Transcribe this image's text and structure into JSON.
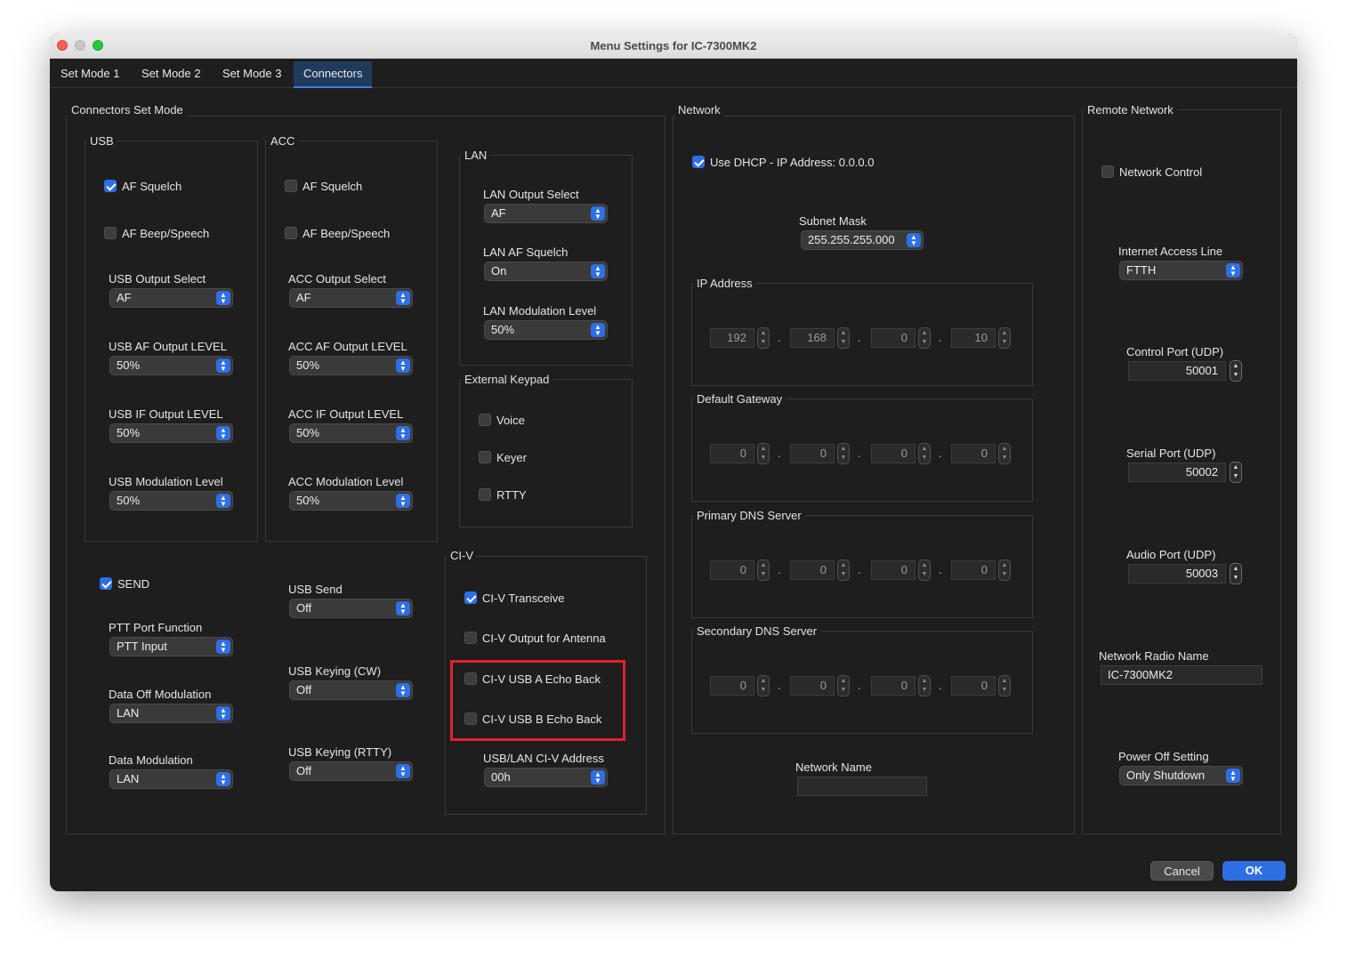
{
  "window": {
    "title": "Menu Settings for IC-7300MK2"
  },
  "colors": {
    "accent": "#2f6fe4",
    "highlight": "#e0222b",
    "close": "#fe5f57",
    "minimize": "#febc2e",
    "zoom": "#28c840"
  },
  "tabs": [
    {
      "label": "Set Mode 1",
      "active": false
    },
    {
      "label": "Set Mode 2",
      "active": false
    },
    {
      "label": "Set Mode 3",
      "active": false
    },
    {
      "label": "Connectors",
      "active": true
    }
  ],
  "connectors": {
    "title": "Connectors Set Mode",
    "usb": {
      "title": "USB",
      "af_squelch": {
        "label": "AF Squelch",
        "checked": true
      },
      "af_beep": {
        "label": "AF Beep/Speech",
        "checked": false
      },
      "output_select": {
        "label": "USB Output Select",
        "value": "AF"
      },
      "af_output_level": {
        "label": "USB AF Output LEVEL",
        "value": "50%"
      },
      "if_output_level": {
        "label": "USB IF Output LEVEL",
        "value": "50%"
      },
      "modulation_level": {
        "label": "USB Modulation Level",
        "value": "50%"
      }
    },
    "acc": {
      "title": "ACC",
      "af_squelch": {
        "label": "AF Squelch",
        "checked": false
      },
      "af_beep": {
        "label": "AF Beep/Speech",
        "checked": false
      },
      "output_select": {
        "label": "ACC Output Select",
        "value": "AF"
      },
      "af_output_level": {
        "label": "ACC AF Output LEVEL",
        "value": "50%"
      },
      "if_output_level": {
        "label": "ACC IF Output LEVEL",
        "value": "50%"
      },
      "modulation_level": {
        "label": "ACC Modulation Level",
        "value": "50%"
      }
    },
    "lan": {
      "title": "LAN",
      "output_select": {
        "label": "LAN Output Select",
        "value": "AF"
      },
      "af_squelch": {
        "label": "LAN AF Squelch",
        "value": "On"
      },
      "modulation_level": {
        "label": "LAN Modulation Level",
        "value": "50%"
      }
    },
    "keypad": {
      "title": "External Keypad",
      "voice": {
        "label": "Voice",
        "checked": false
      },
      "keyer": {
        "label": "Keyer",
        "checked": false
      },
      "rtty": {
        "label": "RTTY",
        "checked": false
      }
    },
    "send": {
      "send": {
        "label": "SEND",
        "checked": true
      },
      "ptt_port": {
        "label": "PTT Port Function",
        "value": "PTT Input"
      },
      "data_off_mod": {
        "label": "Data Off Modulation",
        "value": "LAN"
      },
      "data_mod": {
        "label": "Data Modulation",
        "value": "LAN"
      },
      "usb_send": {
        "label": "USB Send",
        "value": "Off"
      },
      "usb_keying_cw": {
        "label": "USB Keying (CW)",
        "value": "Off"
      },
      "usb_keying_rtty": {
        "label": "USB Keying (RTTY)",
        "value": "Off"
      }
    },
    "civ": {
      "title": "CI-V",
      "transceive": {
        "label": "CI-V Transceive",
        "checked": true
      },
      "output_antenna": {
        "label": "CI-V Output for Antenna",
        "checked": false
      },
      "usb_a_echo": {
        "label": "CI-V USB A Echo Back",
        "checked": false
      },
      "usb_b_echo": {
        "label": "CI-V USB B Echo Back",
        "checked": false
      },
      "address": {
        "label": "USB/LAN CI-V Address",
        "value": "00h"
      }
    }
  },
  "network": {
    "title": "Network",
    "dhcp": {
      "label": "Use DHCP - IP Address: 0.0.0.0",
      "checked": true
    },
    "subnet": {
      "label": "Subnet Mask",
      "value": "255.255.255.000"
    },
    "ip": {
      "title": "IP Address",
      "octets": [
        "192",
        "168",
        "0",
        "10"
      ]
    },
    "gateway": {
      "title": "Default Gateway",
      "octets": [
        "0",
        "0",
        "0",
        "0"
      ]
    },
    "primary_dns": {
      "title": "Primary DNS Server",
      "octets": [
        "0",
        "0",
        "0",
        "0"
      ]
    },
    "secondary_dns": {
      "title": "Secondary DNS Server",
      "octets": [
        "0",
        "0",
        "0",
        "0"
      ]
    },
    "name": {
      "label": "Network Name",
      "value": ""
    }
  },
  "remote": {
    "title": "Remote Network",
    "control": {
      "label": "Network Control",
      "checked": false
    },
    "access_line": {
      "label": "Internet Access Line",
      "value": "FTTH"
    },
    "control_port": {
      "label": "Control Port (UDP)",
      "value": "50001"
    },
    "serial_port": {
      "label": "Serial Port (UDP)",
      "value": "50002"
    },
    "audio_port": {
      "label": "Audio Port (UDP)",
      "value": "50003"
    },
    "radio_name": {
      "label": "Network Radio Name",
      "value": "IC-7300MK2"
    },
    "power_off": {
      "label": "Power Off Setting",
      "value": "Only Shutdown"
    }
  },
  "buttons": {
    "cancel": "Cancel",
    "ok": "OK"
  }
}
